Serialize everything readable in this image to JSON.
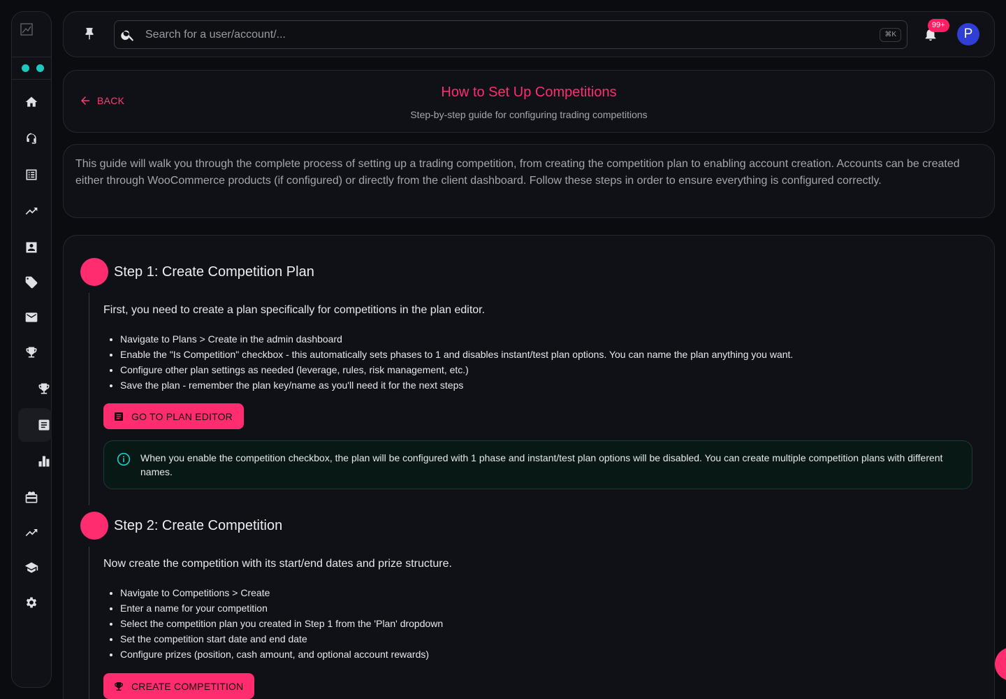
{
  "topbar": {
    "search_placeholder": "Search for a user/account/...",
    "shortcut": "⌘K",
    "notification_badge": "99+",
    "avatar_initial": "P"
  },
  "sidebar": {
    "icons": [
      "home-icon",
      "support-agent-icon",
      "list-icon",
      "trending-up-icon",
      "contact-icon",
      "tag-icon",
      "mail-icon",
      "trophy-icon",
      "trophy-sub-icon",
      "article-icon",
      "bar-chart-icon",
      "card-giftcard-icon",
      "trending-up-alt-icon",
      "school-icon",
      "settings-icon"
    ],
    "active": "article-icon"
  },
  "header": {
    "back_label": "BACK",
    "title": "How to Set Up Competitions",
    "subtitle": "Step-by-step guide for configuring trading competitions"
  },
  "intro": "This guide will walk you through the complete process of setting up a trading competition, from creating the competition plan to enabling account creation. Accounts can be created either through WooCommerce products (if configured) or directly from the client dashboard. Follow these steps in order to ensure everything is configured correctly.",
  "steps": [
    {
      "title": "Step 1: Create Competition Plan",
      "description": "First, you need to create a plan specifically for competitions in the plan editor.",
      "items": [
        "Navigate to Plans > Create in the admin dashboard",
        "Enable the \"Is Competition\" checkbox - this automatically sets phases to 1 and disables instant/test plan options. You can name the plan anything you want.",
        "Configure other plan settings as needed (leverage, rules, risk management, etc.)",
        "Save the plan - remember the plan key/name as you'll need it for the next steps"
      ],
      "button": "GO TO PLAN EDITOR",
      "info": "When you enable the competition checkbox, the plan will be configured with 1 phase and instant/test plan options will be disabled. You can create multiple competition plans with different names."
    },
    {
      "title": "Step 2: Create Competition",
      "description": "Now create the competition with its start/end dates and prize structure.",
      "items": [
        "Navigate to Competitions > Create",
        "Enter a name for your competition",
        "Select the competition plan you created in Step 1 from the 'Plan' dropdown",
        "Set the competition start date and end date",
        "Configure prizes (position, cash amount, and optional account rewards)"
      ],
      "button": "CREATE COMPETITION"
    }
  ],
  "colors": {
    "accent": "#ff2d6f",
    "teal": "#1fc7c1",
    "background": "#0b0c10",
    "card": "#101116"
  }
}
